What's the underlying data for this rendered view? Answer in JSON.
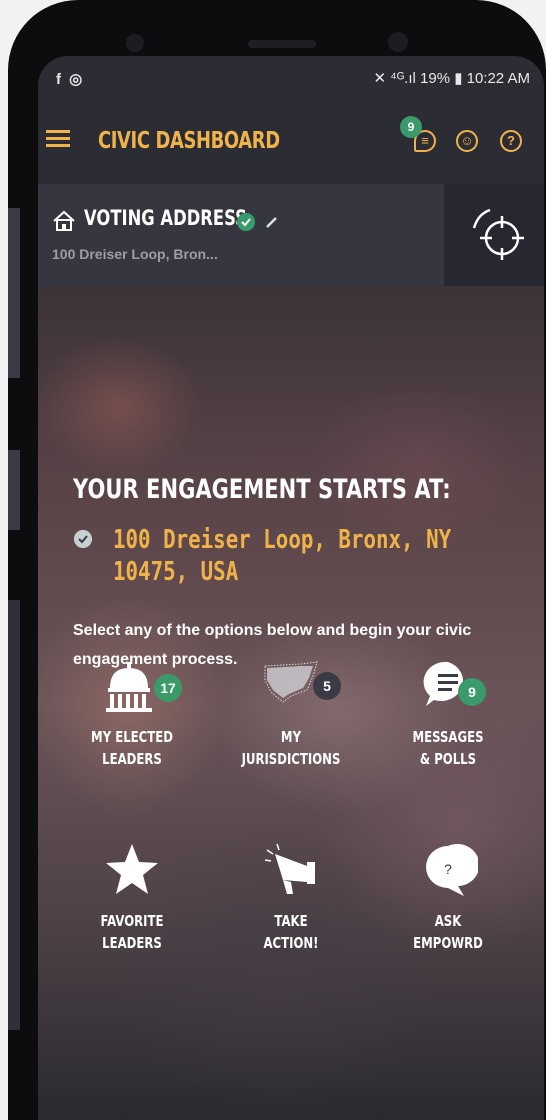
{
  "status_bar": {
    "left_icons": "f ◎",
    "right_text": "✕ ⁴ᴳ.ıl 19% ▮ 10:22 AM"
  },
  "app_bar": {
    "title": "CIVIC DASHBOARD",
    "messages_badge": "9",
    "accent_color": "#f0b34a"
  },
  "voting_address": {
    "label": "VOTING ADDRESS",
    "value": "100 Dreiser Loop, Bron..."
  },
  "hero": {
    "title": "YOUR ENGAGEMENT STARTS AT:",
    "address": "100 Dreiser Loop, Bronx, NY 10475, USA",
    "description": "Select any of the options below and begin your civic engagement process."
  },
  "tiles": [
    {
      "label_1": "MY ELECTED",
      "label_2": "LEADERS",
      "count": "17",
      "icon": "capitol-icon"
    },
    {
      "label_1": "MY",
      "label_2": "JURISDICTIONS",
      "count": "5",
      "icon": "us-map-icon"
    },
    {
      "label_1": "MESSAGES",
      "label_2": "& POLLS",
      "count": "9",
      "icon": "message-icon"
    },
    {
      "label_1": "FAVORITE",
      "label_2": "LEADERS",
      "icon": "star-icon"
    },
    {
      "label_1": "TAKE",
      "label_2": "ACTION!",
      "icon": "megaphone-icon"
    },
    {
      "label_1": "ASK",
      "label_2": "EMPOWRD",
      "icon": "question-bubble-icon"
    }
  ]
}
